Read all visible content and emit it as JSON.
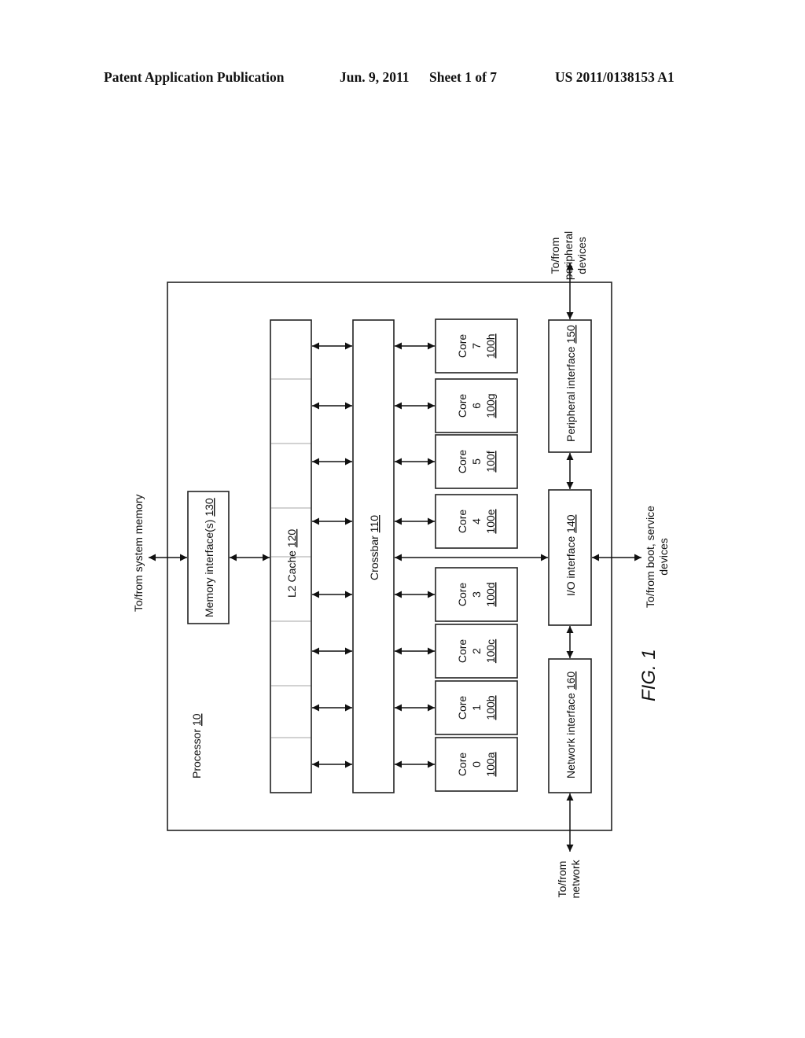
{
  "header": {
    "left": "Patent Application Publication",
    "date": "Jun. 9, 2011",
    "sheet": "Sheet 1 of 7",
    "number": "US 2011/0138153 A1"
  },
  "figure": {
    "caption": "FIG. 1",
    "processor": {
      "label": "Processor",
      "ref": "10"
    },
    "memory_interface": {
      "label": "Memory interface(s)",
      "ref": "130"
    },
    "l2_cache": {
      "label": "L2 Cache",
      "ref": "120",
      "banks": 8
    },
    "crossbar": {
      "label": "Crossbar",
      "ref": "110"
    },
    "cores": [
      {
        "label": "Core",
        "num": "0",
        "ref": "100a"
      },
      {
        "label": "Core",
        "num": "1",
        "ref": "100b"
      },
      {
        "label": "Core",
        "num": "2",
        "ref": "100c"
      },
      {
        "label": "Core",
        "num": "3",
        "ref": "100d"
      },
      {
        "label": "Core",
        "num": "4",
        "ref": "100e"
      },
      {
        "label": "Core",
        "num": "5",
        "ref": "100f"
      },
      {
        "label": "Core",
        "num": "6",
        "ref": "100g"
      },
      {
        "label": "Core",
        "num": "7",
        "ref": "100h"
      }
    ],
    "network_interface": {
      "label": "Network interface",
      "ref": "160"
    },
    "io_interface": {
      "label": "I/O interface",
      "ref": "140"
    },
    "peripheral_interface": {
      "label": "Peripheral interface",
      "ref": "150"
    },
    "external": {
      "system_memory": "To/from system memory",
      "peripheral_line1": "To/from",
      "peripheral_line2": "peripheral",
      "peripheral_line3": "devices",
      "network_line1": "To/from",
      "network_line2": "network",
      "boot_line1": "To/from boot, service",
      "boot_line2": "devices"
    }
  }
}
